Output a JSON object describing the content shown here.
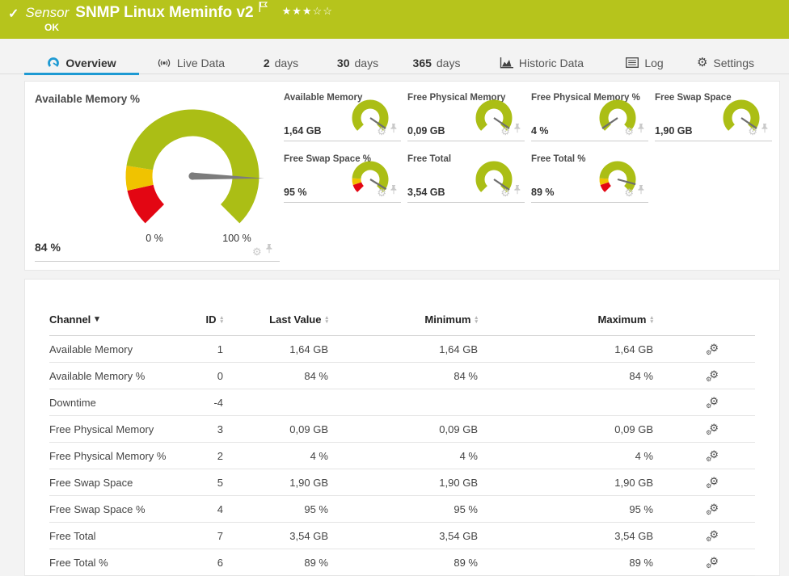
{
  "header": {
    "kind": "Sensor",
    "title": "SNMP Linux Meminfo v2",
    "status": "OK",
    "rating": {
      "filled": 3,
      "empty": 2
    }
  },
  "tabs": {
    "overview": {
      "label": "Overview"
    },
    "live_data": {
      "label": "Live Data"
    },
    "days2": {
      "num": "2",
      "unit": "days"
    },
    "days30": {
      "num": "30",
      "unit": "days"
    },
    "days365": {
      "num": "365",
      "unit": "days"
    },
    "historic": {
      "label": "Historic Data"
    },
    "log": {
      "label": "Log"
    },
    "settings": {
      "label": "Settings"
    }
  },
  "colors": {
    "header_green": "#b6c41c",
    "gauge_green": "#abbe15",
    "gauge_yellow": "#f0c300",
    "gauge_red": "#e30613",
    "active_tab_blue": "#1e9ad3",
    "needle_gray": "#7c7c7c"
  },
  "main_gauge": {
    "label": "Available Memory %",
    "value": "84 %",
    "percent": 84,
    "min_label": "0 %",
    "max_label": "100 %",
    "segments": [
      {
        "from": 0,
        "to": 12,
        "color": "#e30613"
      },
      {
        "from": 12,
        "to": 20,
        "color": "#f0c300"
      },
      {
        "from": 20,
        "to": 100,
        "color": "#abbe15"
      }
    ]
  },
  "small_gauges": [
    {
      "label": "Available Memory",
      "value": "1,64 GB",
      "percent": 96,
      "segments": [
        {
          "from": 0,
          "to": 100,
          "color": "#abbe15"
        }
      ]
    },
    {
      "label": "Free Physical Memory",
      "value": "0,09 GB",
      "percent": 96,
      "segments": [
        {
          "from": 0,
          "to": 100,
          "color": "#abbe15"
        }
      ]
    },
    {
      "label": "Free Physical Memory %",
      "value": "4 %",
      "percent": 4,
      "segments": [
        {
          "from": 0,
          "to": 100,
          "color": "#abbe15"
        }
      ]
    },
    {
      "label": "Free Swap Space",
      "value": "1,90 GB",
      "percent": 96,
      "segments": [
        {
          "from": 0,
          "to": 100,
          "color": "#abbe15"
        }
      ]
    },
    {
      "label": "Free Swap Space %",
      "value": "95 %",
      "percent": 95,
      "segments": [
        {
          "from": 0,
          "to": 10,
          "color": "#e30613"
        },
        {
          "from": 10,
          "to": 18,
          "color": "#f0c300"
        },
        {
          "from": 18,
          "to": 100,
          "color": "#abbe15"
        }
      ]
    },
    {
      "label": "Free Total",
      "value": "3,54 GB",
      "percent": 96,
      "segments": [
        {
          "from": 0,
          "to": 100,
          "color": "#abbe15"
        }
      ]
    },
    {
      "label": "Free Total %",
      "value": "89 %",
      "percent": 89,
      "segments": [
        {
          "from": 0,
          "to": 10,
          "color": "#e30613"
        },
        {
          "from": 10,
          "to": 18,
          "color": "#f0c300"
        },
        {
          "from": 18,
          "to": 100,
          "color": "#abbe15"
        }
      ]
    }
  ],
  "table": {
    "headers": {
      "channel": "Channel",
      "id": "ID",
      "last": "Last Value",
      "min": "Minimum",
      "max": "Maximum"
    },
    "rows": [
      {
        "channel": "Available Memory",
        "id": "1",
        "last": "1,64 GB",
        "min": "1,64 GB",
        "max": "1,64 GB"
      },
      {
        "channel": "Available Memory %",
        "id": "0",
        "last": "84 %",
        "min": "84 %",
        "max": "84 %"
      },
      {
        "channel": "Downtime",
        "id": "-4",
        "last": "",
        "min": "",
        "max": ""
      },
      {
        "channel": "Free Physical Memory",
        "id": "3",
        "last": "0,09 GB",
        "min": "0,09 GB",
        "max": "0,09 GB"
      },
      {
        "channel": "Free Physical Memory %",
        "id": "2",
        "last": "4 %",
        "min": "4 %",
        "max": "4 %"
      },
      {
        "channel": "Free Swap Space",
        "id": "5",
        "last": "1,90 GB",
        "min": "1,90 GB",
        "max": "1,90 GB"
      },
      {
        "channel": "Free Swap Space %",
        "id": "4",
        "last": "95 %",
        "min": "95 %",
        "max": "95 %"
      },
      {
        "channel": "Free Total",
        "id": "7",
        "last": "3,54 GB",
        "min": "3,54 GB",
        "max": "3,54 GB"
      },
      {
        "channel": "Free Total %",
        "id": "6",
        "last": "89 %",
        "min": "89 %",
        "max": "89 %"
      }
    ]
  }
}
